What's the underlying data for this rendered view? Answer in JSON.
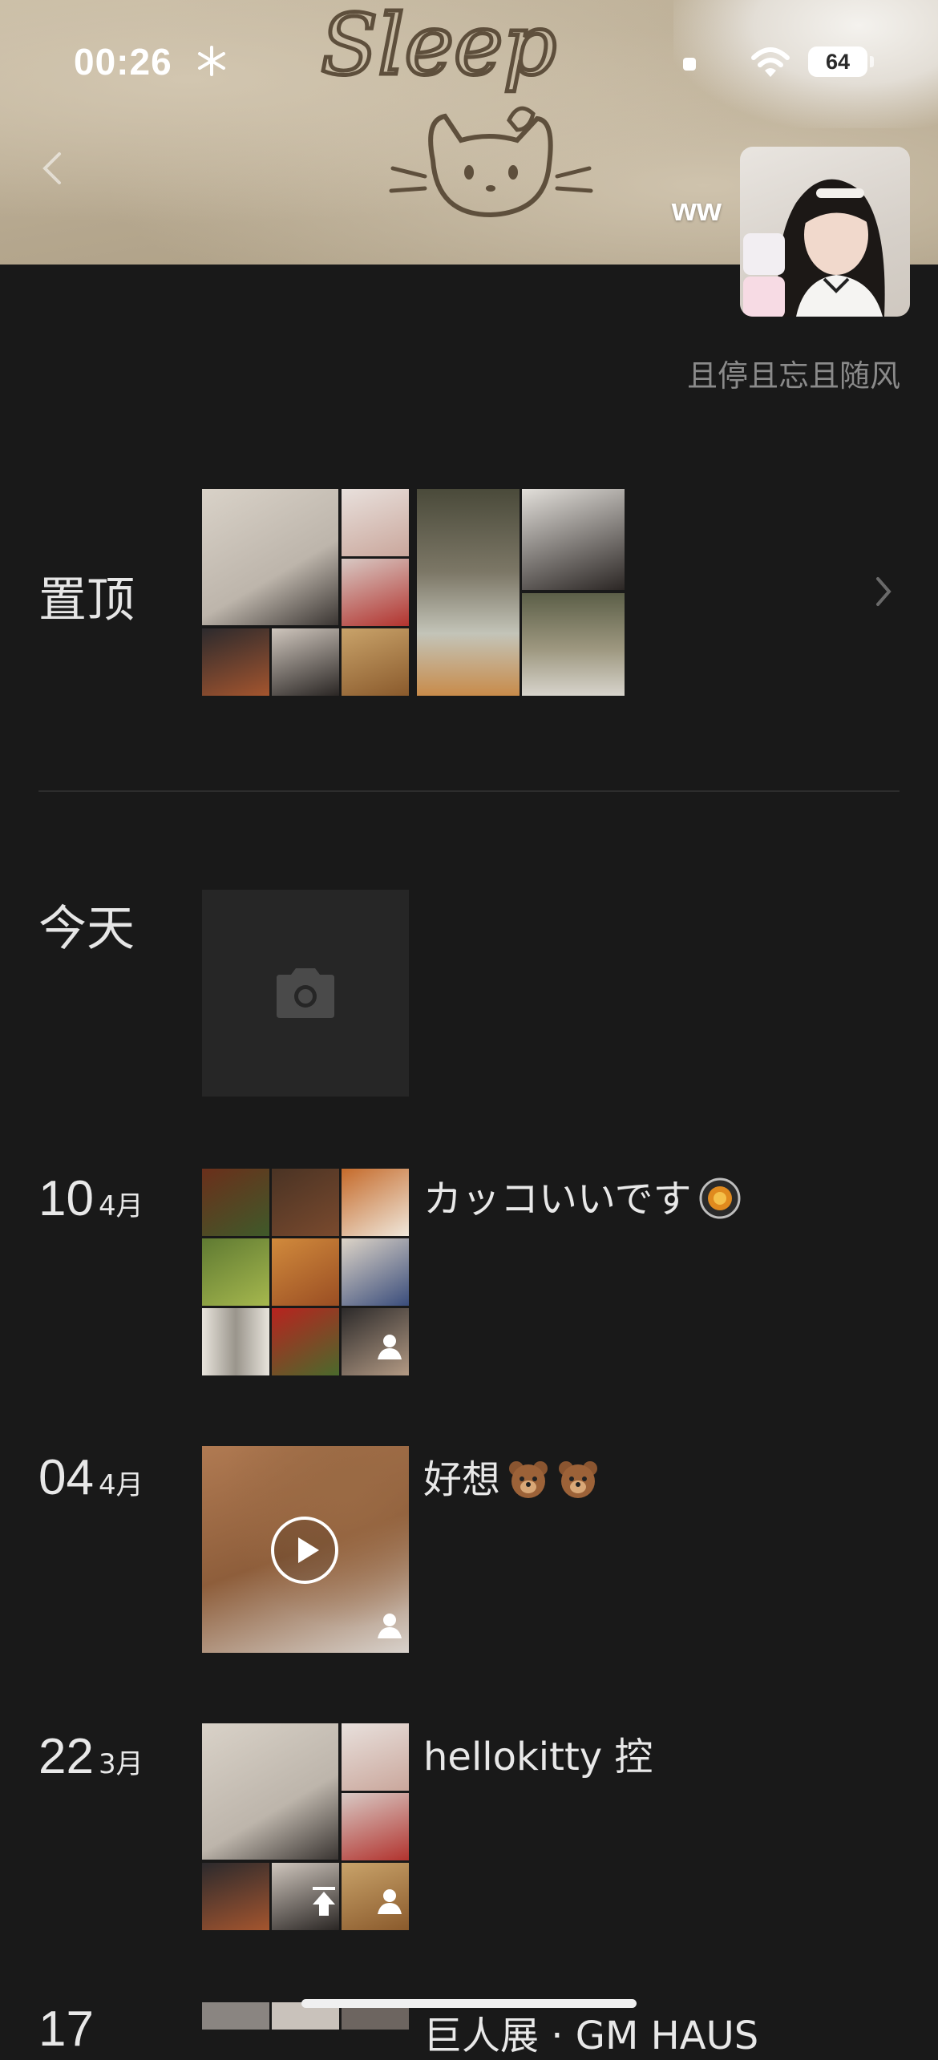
{
  "status_bar": {
    "time": "00:26",
    "battery": "64"
  },
  "profile": {
    "cover_text": "Sleep",
    "name": "ww",
    "signature": "且停且忘且随风"
  },
  "pinned": {
    "label": "置顶"
  },
  "today": {
    "label": "今天"
  },
  "posts": [
    {
      "day": "10",
      "month": "4月",
      "caption": "カッコいいです"
    },
    {
      "day": "04",
      "month": "4月",
      "caption": "好想"
    },
    {
      "day": "22",
      "month": "3月",
      "caption": "hellokitty 控"
    },
    {
      "day": "17",
      "month": "",
      "caption": "巨人展 · GM HAUS"
    }
  ],
  "icons": [
    "snowflake-icon",
    "signal-icon",
    "wifi-icon",
    "battery-icon",
    "chevron-left-icon",
    "chevron-right-icon",
    "camera-icon",
    "play-icon",
    "friends-visible-icon",
    "pin-top-icon",
    "bear-emoji-icon",
    "dish-emoji-icon"
  ],
  "colors": {
    "background": "#191919",
    "text": "#e8e8e8",
    "muted": "#8a8a8a",
    "camera_tile": "#262626"
  }
}
